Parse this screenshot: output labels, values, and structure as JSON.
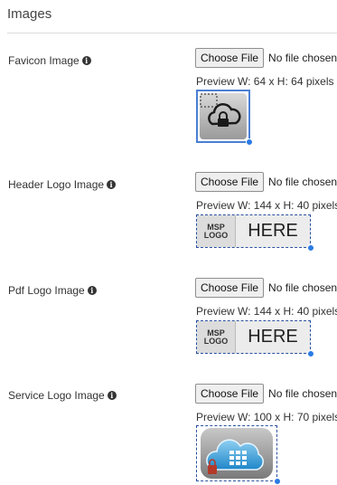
{
  "section": {
    "title": "Images"
  },
  "fields": [
    {
      "label": "Favicon Image",
      "button_label": "Choose File",
      "file_status": "No file chosen",
      "preview_text": "Preview W: 64 x H: 64 pixels"
    },
    {
      "label": "Header Logo Image",
      "button_label": "Choose File",
      "file_status": "No file chosen",
      "preview_text": "Preview W: 144 x H: 40 pixels",
      "logo_small": "MSP LOGO",
      "logo_big": "HERE"
    },
    {
      "label": "Pdf Logo Image",
      "button_label": "Choose File",
      "file_status": "No file chosen",
      "preview_text": "Preview W: 144 x H: 40 pixels",
      "logo_small": "MSP LOGO",
      "logo_big": "HERE"
    },
    {
      "label": "Service Logo Image",
      "button_label": "Choose File",
      "file_status": "No file chosen",
      "preview_text": "Preview W: 100 x H: 70 pixels"
    }
  ],
  "colors": {
    "accent": "#2b7be4",
    "dashed_border": "#2a4fa0"
  },
  "icons": {
    "info": "info-circle-icon",
    "cloud": "cloud-lock-icon"
  }
}
